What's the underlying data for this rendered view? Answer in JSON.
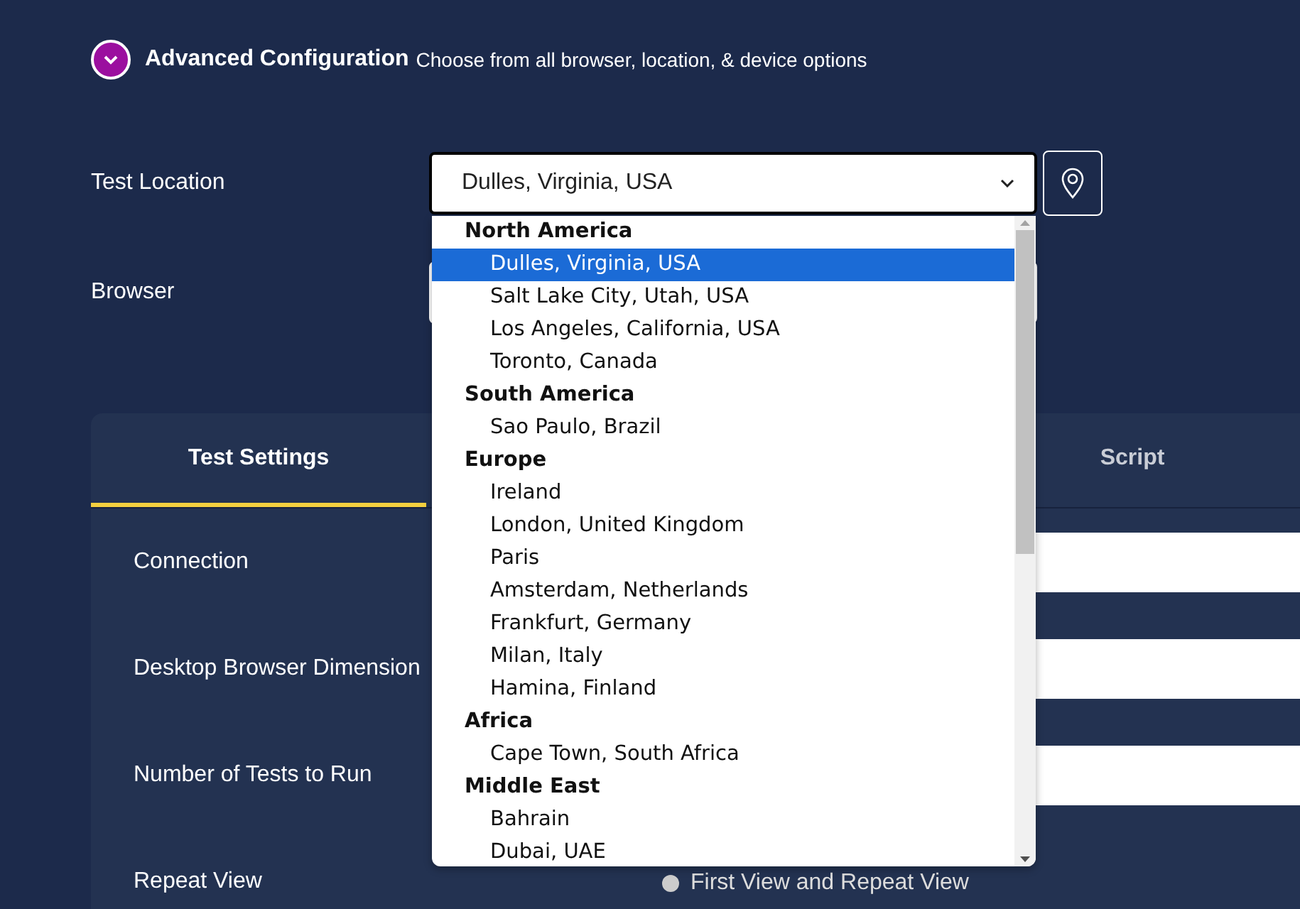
{
  "advanced": {
    "title": "Advanced Configuration",
    "subtitle": "Choose from all browser, location, & device options",
    "expanded": true
  },
  "test_location": {
    "label": "Test Location",
    "value": "Dulles, Virginia, USA",
    "open": true,
    "groups": [
      {
        "label": "North America",
        "options": [
          {
            "label": "Dulles, Virginia, USA",
            "selected": true
          },
          {
            "label": "Salt Lake City, Utah, USA",
            "selected": false
          },
          {
            "label": "Los Angeles, California, USA",
            "selected": false
          },
          {
            "label": "Toronto, Canada",
            "selected": false
          }
        ]
      },
      {
        "label": "South America",
        "options": [
          {
            "label": "Sao Paulo, Brazil",
            "selected": false
          }
        ]
      },
      {
        "label": "Europe",
        "options": [
          {
            "label": "Ireland",
            "selected": false
          },
          {
            "label": "London, United Kingdom",
            "selected": false
          },
          {
            "label": "Paris",
            "selected": false
          },
          {
            "label": "Amsterdam, Netherlands",
            "selected": false
          },
          {
            "label": "Frankfurt, Germany",
            "selected": false
          },
          {
            "label": "Milan, Italy",
            "selected": false
          },
          {
            "label": "Hamina, Finland",
            "selected": false
          }
        ]
      },
      {
        "label": "Africa",
        "options": [
          {
            "label": "Cape Town, South Africa",
            "selected": false
          }
        ]
      },
      {
        "label": "Middle East",
        "options": [
          {
            "label": "Bahrain",
            "selected": false
          },
          {
            "label": "Dubai, UAE",
            "selected": false
          }
        ]
      }
    ]
  },
  "browser": {
    "label": "Browser"
  },
  "tabs": [
    {
      "label": "Test Settings",
      "selected": true
    },
    {
      "label": "Script",
      "selected": false
    }
  ],
  "settings": [
    {
      "kind": "field",
      "label": "Connection"
    },
    {
      "kind": "field",
      "label": "Desktop Browser Dimension"
    },
    {
      "kind": "field",
      "label": "Number of Tests to Run"
    },
    {
      "kind": "radio",
      "label": "Repeat View",
      "option": "First View and Repeat View",
      "checked": false
    }
  ]
}
